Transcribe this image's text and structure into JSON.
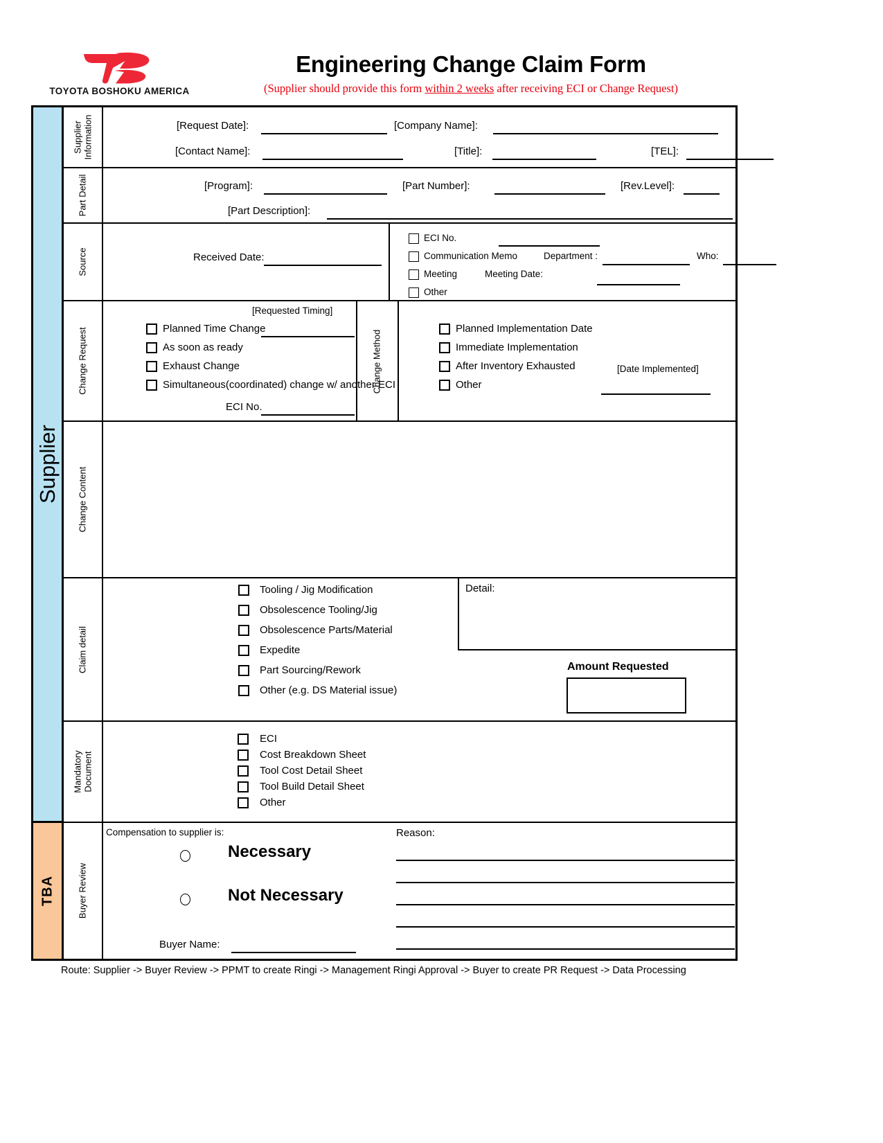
{
  "header": {
    "logo_text": "TOYOTA BOSHOKU AMERICA",
    "logo_icon": "tb-logo-icon",
    "title": "Engineering Change Claim Form",
    "subtitle_before": "(Supplier should provide this form ",
    "subtitle_underlined": "within 2 weeks",
    "subtitle_after": " after receiving ECI or Change Request)",
    "accent_color": "#e8000d"
  },
  "groups": {
    "supplier": "Supplier",
    "tba": "TBA",
    "supplier_color": "#b8e2f2",
    "tba_color": "#fac79a"
  },
  "sections": {
    "supplier_information": {
      "label_line1": "Supplier",
      "label_line2": "Information",
      "fields": {
        "request_date": "[Request Date]:",
        "company_name": "[Company Name]:",
        "contact_name": "[Contact Name]:",
        "title": "[Title]:",
        "tel": "[TEL]:"
      }
    },
    "part_detail": {
      "label": "Part Detail",
      "fields": {
        "program": "[Program]:",
        "part_number": "[Part Number]:",
        "rev_level": "[Rev.Level]:",
        "part_description": "[Part Description]:"
      }
    },
    "source": {
      "label": "Source",
      "received_date": "Received Date:",
      "checkboxes": [
        "ECI No.",
        "Communication Memo",
        "Meeting",
        "Other"
      ],
      "department": "Department :",
      "who": "Who:",
      "meeting_date": "Meeting Date:"
    },
    "change_request": {
      "label": "Change Request",
      "requested_timing": "[Requested Timing]",
      "checkboxes": [
        "Planned Time Change",
        "As soon as ready",
        "Exhaust Change",
        "Simultaneous(coordinated) change w/ another ECI"
      ],
      "eci_no": "ECI No."
    },
    "change_method": {
      "label": "Change Method",
      "checkboxes": [
        "Planned Implementation Date",
        "Immediate Implementation",
        "After Inventory Exhausted",
        "Other"
      ],
      "date_implemented": "[Date Implemented]"
    },
    "change_content": {
      "label": "Change Content"
    },
    "claim_detail": {
      "label": "Claim detail",
      "checkboxes": [
        "Tooling / Jig Modification",
        "Obsolescence Tooling/Jig",
        "Obsolescence Parts/Material",
        "Expedite",
        "Part Sourcing/Rework",
        "Other (e.g. DS Material issue)"
      ],
      "detail_label": "Detail:",
      "amount_requested": "Amount Requested"
    },
    "mandatory_document": {
      "label_line1": "Mandatory",
      "label_line2": "Document",
      "checkboxes": [
        "ECI",
        "Cost Breakdown Sheet",
        "Tool Cost Detail Sheet",
        "Tool Build Detail Sheet",
        "Other"
      ]
    },
    "buyer_review": {
      "label": "Buyer Review",
      "compensation_label": "Compensation to supplier is:",
      "option_necessary": "Necessary",
      "option_not_necessary": "Not Necessary",
      "reason_label": "Reason:",
      "buyer_name": "Buyer Name:"
    }
  },
  "footer": {
    "route": "Route: Supplier -> Buyer Review -> PPMT to create Ringi  -> Management Ringi Approval -> Buyer to create PR Request -> Data Processing"
  }
}
